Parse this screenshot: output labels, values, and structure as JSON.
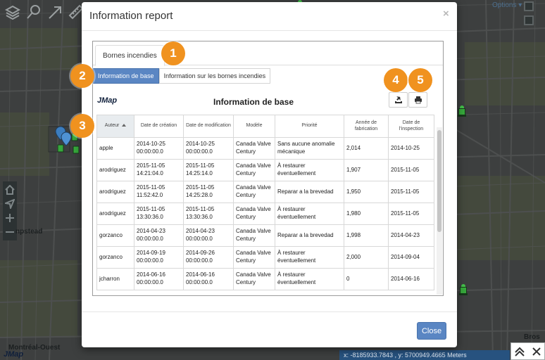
{
  "toolbar": {
    "icons": [
      "layers-icon",
      "search-icon",
      "arrow-tool-icon",
      "ruler-icon"
    ]
  },
  "map": {
    "options_label": "Options ▾",
    "place_labels": [
      "npstead",
      "Montréal-Ouest",
      "Bros"
    ],
    "logo": "JMap",
    "coordinates": "x: -8185933.7843 , y: 5700949.4665 Meters"
  },
  "modal": {
    "title": "Information report",
    "close_glyph": "×",
    "outer_tab": "Bornes incendies",
    "inner_tabs": [
      "Information de base",
      "Information sur les bornes incendies"
    ],
    "report_logo": "JMap",
    "report_title": "Information de base",
    "footer_close": "Close"
  },
  "table": {
    "columns": [
      "Auteur",
      "Date de création",
      "Date de modification",
      "Modèle",
      "Priorité",
      "Année de fabrication",
      "Date de l'inspection"
    ],
    "sorted_column": "Auteur",
    "rows": [
      [
        "apple",
        "2014-10-25\n00:00:00.0",
        "2014-10-25\n00:00:00.0",
        "Canada Valve\nCentury",
        "Sans aucune anomalie\nmécanique",
        "2,014",
        "2014-10-25"
      ],
      [
        "arodriguez",
        "2015-11-05\n14:21:04.0",
        "2015-11-05\n14:25:14.0",
        "Canada Valve\nCentury",
        "À restaurer\néventuellement",
        "1,907",
        "2015-11-05"
      ],
      [
        "arodriguez",
        "2015-11-05\n11:52:42.0",
        "2015-11-05\n14:25:28.0",
        "Canada Valve\nCentury",
        "Reparar a la brevedad",
        "1,950",
        "2015-11-05"
      ],
      [
        "arodriguez",
        "2015-11-05\n13:30:36.0",
        "2015-11-05\n13:30:36.0",
        "Canada Valve\nCentury",
        "À restaurer\néventuellement",
        "1,980",
        "2015-11-05"
      ],
      [
        "gorzanco",
        "2014-04-23\n00:00:00.0",
        "2014-04-23\n00:00:00.0",
        "Canada Valve\nCentury",
        "Reparar a la brevedad",
        "1,998",
        "2014-04-23"
      ],
      [
        "gorzanco",
        "2014-09-19\n00:00:00.0",
        "2014-09-26\n00:00:00.0",
        "Canada Valve\nCentury",
        "À restaurer\néventuellement",
        "2,000",
        "2014-09-04"
      ],
      [
        "jcharron",
        "2014-06-16\n00:00:00.0",
        "2014-06-16\n00:00:00.0",
        "Canada Valve\nCentury",
        "À restaurer\néventuellement",
        "0",
        "2014-06-16"
      ]
    ]
  },
  "callouts": [
    "1",
    "2",
    "3",
    "4",
    "5"
  ],
  "colors": {
    "accent": "#5a86c3",
    "callout": "#f0921f",
    "hydrant": "#37a93c",
    "coords_bar": "#27527f"
  }
}
